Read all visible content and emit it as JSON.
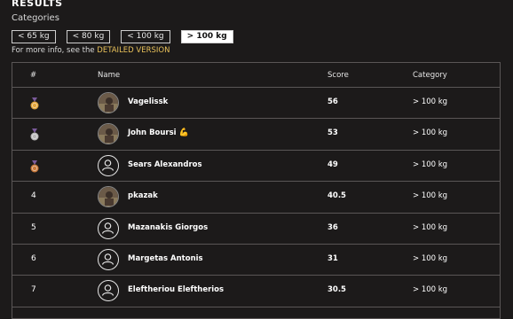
{
  "page": {
    "title": "RESULTS",
    "categories_label": "Categories",
    "filters": [
      "< 65 kg",
      "< 80 kg",
      "< 100 kg",
      "> 100 kg"
    ],
    "active_filter_index": 3,
    "info_text": "For more info, see the",
    "info_link": "DETAILED VERSION"
  },
  "table": {
    "headers": {
      "rank": "#",
      "name": "Name",
      "score": "Score",
      "category": "Category"
    },
    "rows": [
      {
        "rank": "",
        "medal": "gold-medal-icon",
        "avatar": "photo",
        "name": "Vagelissk",
        "score": "56",
        "category": "> 100 kg"
      },
      {
        "rank": "",
        "medal": "silver-medal-icon",
        "avatar": "photo",
        "name": "John Boursi",
        "emoji": "💪",
        "score": "53",
        "category": "> 100 kg"
      },
      {
        "rank": "",
        "medal": "bronze-medal-icon",
        "avatar": "default-user-icon",
        "name": "Sears Alexandros",
        "score": "49",
        "category": "> 100 kg"
      },
      {
        "rank": "4",
        "medal": "",
        "avatar": "photo",
        "name": "pkazak",
        "score": "40.5",
        "category": "> 100 kg"
      },
      {
        "rank": "5",
        "medal": "",
        "avatar": "default-user-icon",
        "name": "Mazanakis Giorgos",
        "score": "36",
        "category": "> 100 kg"
      },
      {
        "rank": "6",
        "medal": "",
        "avatar": "default-user-icon",
        "name": "Margetas Antonis",
        "score": "31",
        "category": "> 100 kg"
      },
      {
        "rank": "7",
        "medal": "",
        "avatar": "default-user-icon",
        "name": "Eleftheriou Eleftherios",
        "score": "30.5",
        "category": "> 100 kg"
      }
    ]
  },
  "colors": {
    "background": "#1c1a1a",
    "link": "#e8c15a",
    "gold": "#e3a53a",
    "silver": "#b9b9b9",
    "bronze": "#c9793a"
  }
}
